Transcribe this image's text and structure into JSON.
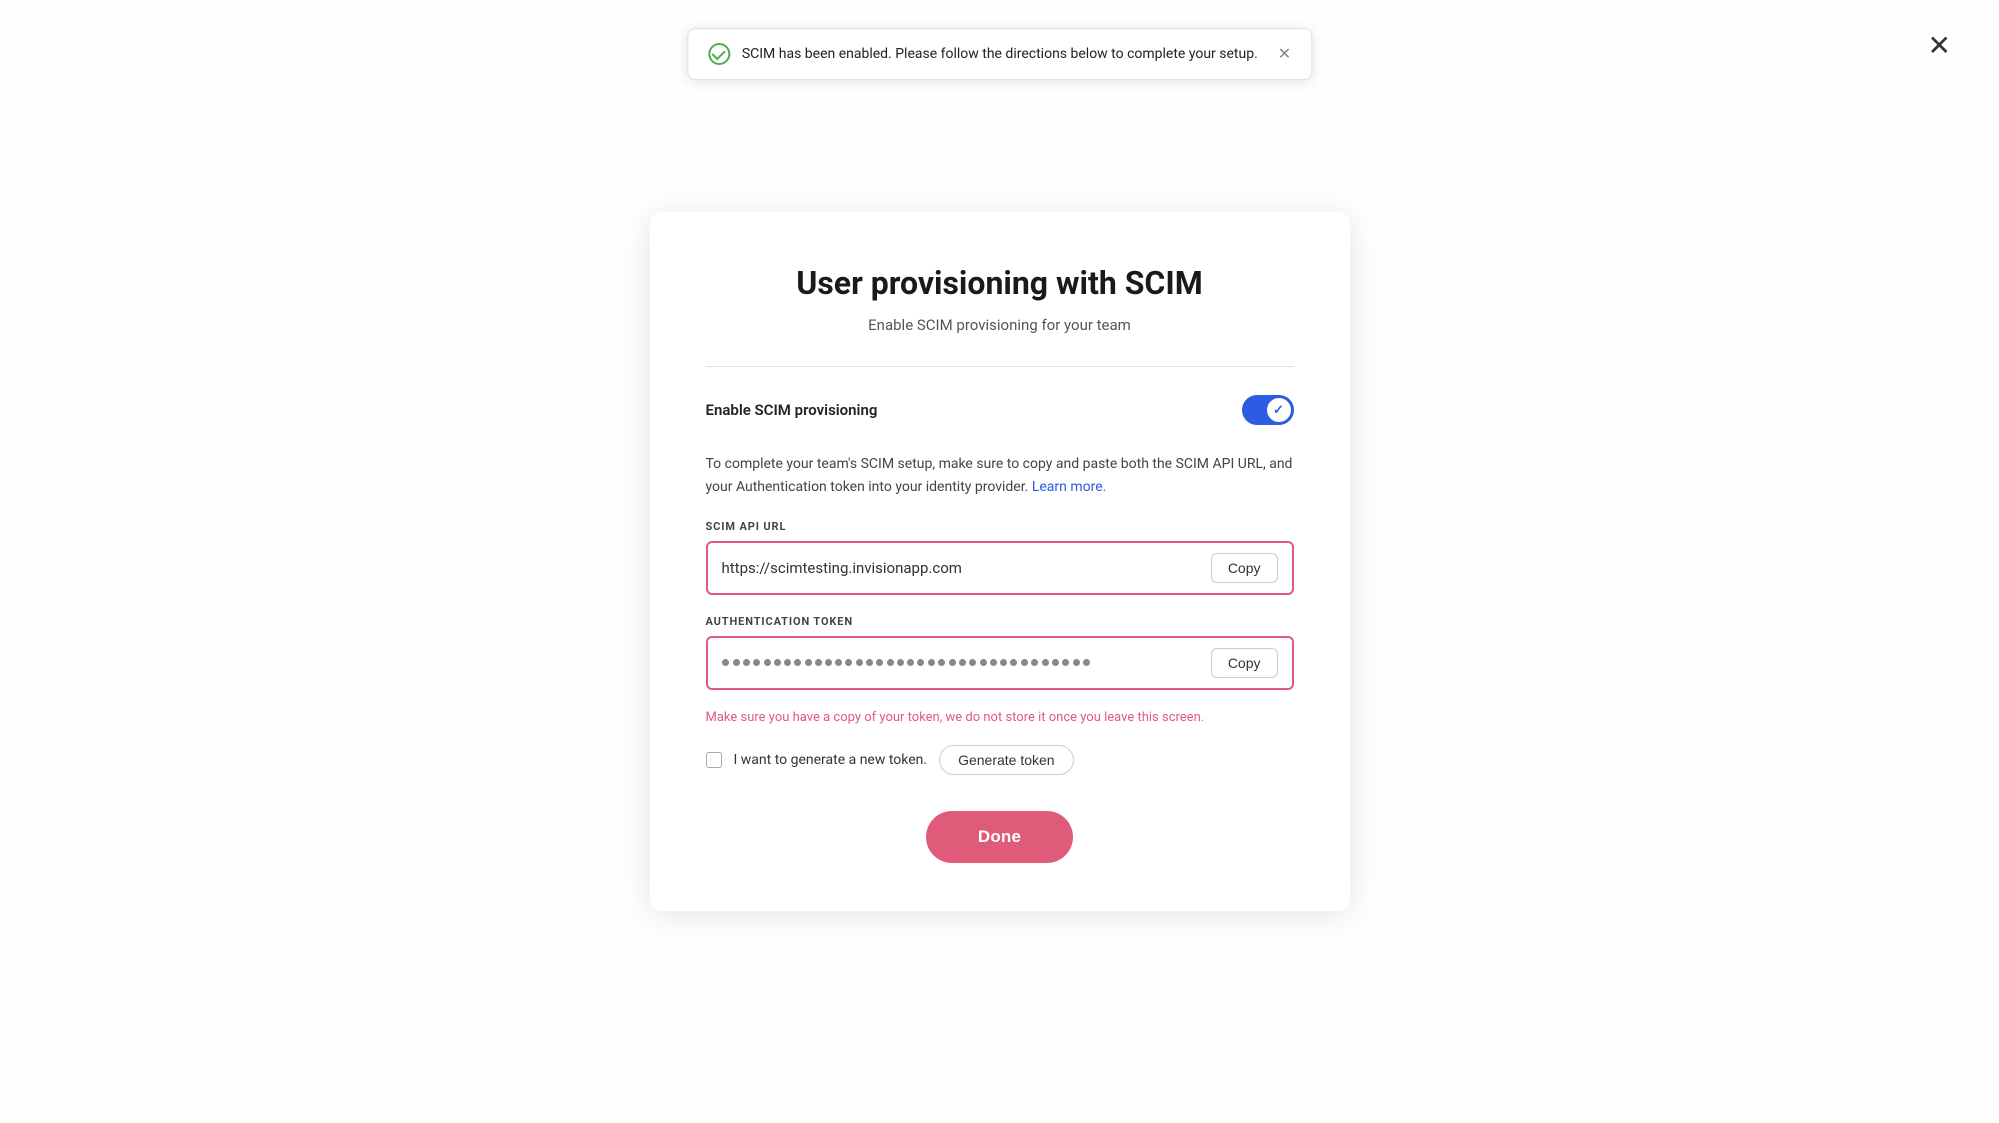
{
  "page": {
    "background": "#f5f5f5"
  },
  "close_icon": "✕",
  "toast": {
    "message": "SCIM has been enabled. Please follow the directions below to complete your setup.",
    "close_label": "✕"
  },
  "modal": {
    "title": "User provisioning with SCIM",
    "subtitle": "Enable SCIM provisioning for your team",
    "toggle_label": "Enable SCIM provisioning",
    "toggle_on": true,
    "description_part1": "To complete your team's SCIM setup, make sure to copy and paste both the SCIM API URL, and your Authentication token into your identity provider.",
    "learn_more_label": "Learn more.",
    "learn_more_href": "#",
    "scim_url_label": "SCIM API URL",
    "scim_url_value": "https://scimtesting.invisionapp.com",
    "copy_url_label": "Copy",
    "auth_token_label": "Authentication token",
    "copy_token_label": "Copy",
    "warning_text": "Make sure you have a copy of your token, we do not store it once you leave this screen.",
    "new_token_label": "I want to generate a new token.",
    "generate_button_label": "Generate token",
    "done_label": "Done"
  }
}
